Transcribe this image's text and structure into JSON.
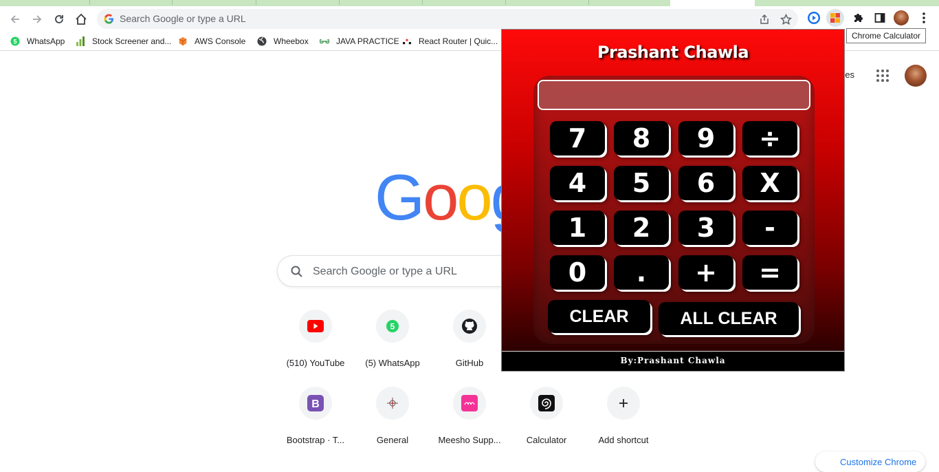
{
  "toolbar": {
    "omnibox_placeholder": "Search Google or type a URL",
    "back_icon": "arrow-left-icon",
    "forward_icon": "arrow-right-icon",
    "reload_icon": "reload-icon",
    "home_icon": "home-icon"
  },
  "bookmarks": [
    {
      "label": "WhatsApp",
      "icon": "whatsapp-icon"
    },
    {
      "label": "Stock Screener and...",
      "icon": "bars-icon"
    },
    {
      "label": "AWS  Console",
      "icon": "cube-icon"
    },
    {
      "label": "Wheebox",
      "icon": "globe-icon"
    },
    {
      "label": "JAVA PRACTICE",
      "icon": "gfg-icon"
    },
    {
      "label": "React Router | Quic...",
      "icon": "react-router-icon"
    }
  ],
  "tooltip": "Chrome Calculator",
  "google": {
    "images_link": "ges",
    "search_placeholder": "Search Google or type a URL",
    "logo_letters": [
      "G",
      "o",
      "o",
      "g"
    ],
    "logo_colors": [
      "#4285F4",
      "#EA4335",
      "#FBBC05",
      "#4285F4"
    ],
    "shortcuts_row1": [
      {
        "label": "(510) YouTube",
        "icon": "youtube-icon"
      },
      {
        "label": "(5) WhatsApp",
        "icon": "whatsapp-icon"
      },
      {
        "label": "GitHub",
        "icon": "github-icon"
      }
    ],
    "shortcuts_row2": [
      {
        "label": "Bootstrap · T...",
        "icon": "bootstrap-icon"
      },
      {
        "label": "General",
        "icon": "compass-icon"
      },
      {
        "label": "Meesho Supp...",
        "icon": "meesho-icon"
      },
      {
        "label": "Calculator",
        "icon": "spiral-icon"
      },
      {
        "label": "Add shortcut",
        "icon": "plus-icon"
      }
    ],
    "customize_label": "Customize Chrome"
  },
  "calculator": {
    "title": "Prashant Chawla",
    "display_value": "",
    "keys": [
      [
        "7",
        "8",
        "9",
        "÷"
      ],
      [
        "4",
        "5",
        "6",
        "X"
      ],
      [
        "1",
        "2",
        "3",
        "-"
      ],
      [
        "0",
        ".",
        "+",
        "="
      ]
    ],
    "clear_label": "CLEAR",
    "all_clear_label": "ALL CLEAR",
    "footer": "By:Prashant Chawla"
  }
}
